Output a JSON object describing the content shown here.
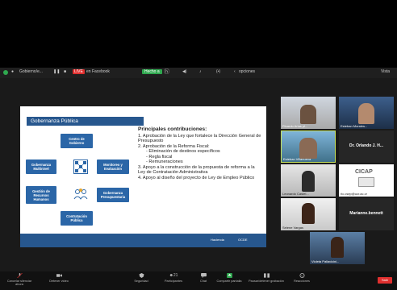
{
  "topbar": {
    "item1": "Gobierno/e...",
    "live": "LIVE",
    "live_target": "en Facebook",
    "green": "Hecho a",
    "options": "opciones",
    "view": "Vista"
  },
  "slide": {
    "title": "Gobernanza Pública",
    "boxes": {
      "centro": "Centro de Gobierno",
      "multinivel": "Gobernanza Multinivel",
      "monitoreo": "Monitoreo y Evaluación",
      "rrhh": "Gestión de Recursos Humanos",
      "presupuestaria": "Gobernanza Presupuestaria",
      "contratacion": "Contratación Pública"
    },
    "contrib": {
      "heading": "Principales contribuciones:",
      "item1": "1. Aprobación de la Ley que fortalece la Dirección General de Presupuesto",
      "item2": "2. Aprobación de la Reforma Fiscal:",
      "sub1": "- Eliminación de destinos específicos",
      "sub2": "- Regla fiscal",
      "sub3": "- Remuneraciones",
      "item3": "3. Apoyo a la construcción de la propuesta de reforma a la Ley de Contratación Administrativa",
      "item4": "4. Apoyo al diseño del proyecto de Ley de Empleo Público"
    },
    "footer_logo1": "Hacienda",
    "footer_logo2": "OCDE"
  },
  "participants": [
    {
      "name": "Ricardo Arias pl..."
    },
    {
      "name": "Esteban Morales..."
    },
    {
      "name": "Esteban Villanueva"
    },
    {
      "name": "Dr. Orlando J. H..."
    },
    {
      "name": "Leonardo Castel..."
    },
    {
      "name": "ric.csep@ucr.ac.cr"
    },
    {
      "name": "Selene Vargas"
    },
    {
      "name": "Marianne.bennett"
    },
    {
      "name": "Violeta Pallavicini..."
    }
  ],
  "cicap": "CICAP",
  "bottombar": {
    "audio": "Cancelar silenciar ahora",
    "video": "Detener video",
    "security": "Seguridad",
    "participants": "Participantes",
    "participants_count": "21",
    "chat": "Chat",
    "share": "Compartir pantalla",
    "record": "Pausar/detener grabación",
    "reactions": "Reacciones",
    "end": "Salir"
  },
  "colors": {
    "accent": "#27578e",
    "live": "#e0302f",
    "share": "#2fa84f"
  }
}
